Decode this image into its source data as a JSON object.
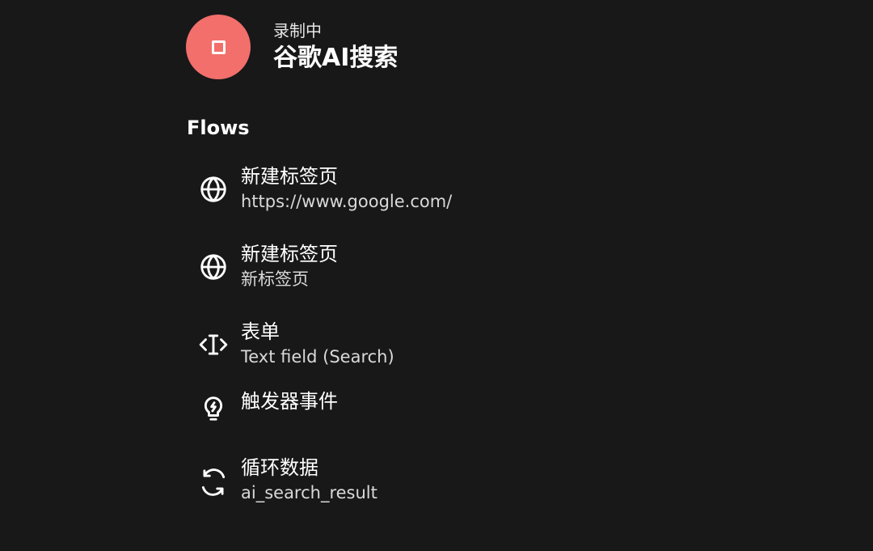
{
  "header": {
    "status": "录制中",
    "title": "谷歌AI搜索",
    "stop_icon": "stop-icon",
    "stop_button_color": "#f26f6b"
  },
  "flows": {
    "heading": "Flows",
    "items": [
      {
        "icon": "globe-icon",
        "title": "新建标签页",
        "subtitle": "https://www.google.com/"
      },
      {
        "icon": "globe-icon",
        "title": "新建标签页",
        "subtitle": "新标签页"
      },
      {
        "icon": "text-field-icon",
        "title": "表单",
        "subtitle": "Text field (Search)"
      },
      {
        "icon": "lightbulb-bolt-icon",
        "title": "触发器事件",
        "subtitle": ""
      },
      {
        "icon": "refresh-loop-icon",
        "title": "循环数据",
        "subtitle": "ai_search_result"
      }
    ]
  },
  "colors": {
    "background": "#181819",
    "text": "#ffffff",
    "accent": "#f26f6b"
  }
}
